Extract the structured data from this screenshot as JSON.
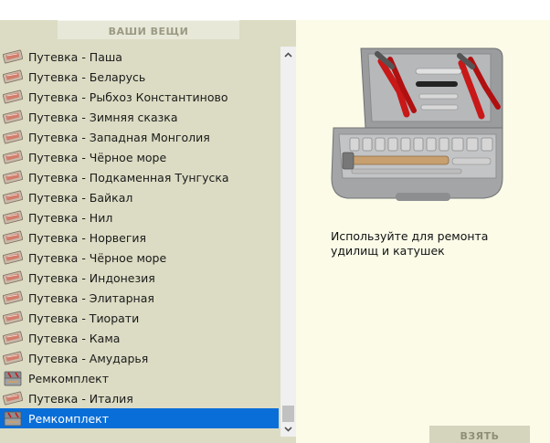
{
  "inventory": {
    "title": "ВАШИ ВЕЩИ",
    "items": [
      {
        "label": "Путевка - Паша",
        "icon": "ticket-icon"
      },
      {
        "label": "Путевка - Беларусь",
        "icon": "ticket-icon"
      },
      {
        "label": "Путевка - Рыбхоз Константиново",
        "icon": "ticket-icon"
      },
      {
        "label": "Путевка - Зимняя сказка",
        "icon": "ticket-icon"
      },
      {
        "label": "Путевка - Западная Монголия",
        "icon": "ticket-icon"
      },
      {
        "label": "Путевка - Чёрное море",
        "icon": "ticket-icon"
      },
      {
        "label": "Путевка - Подкаменная Тунгуска",
        "icon": "ticket-icon"
      },
      {
        "label": "Путевка - Байкал",
        "icon": "ticket-icon"
      },
      {
        "label": "Путевка - Нил",
        "icon": "ticket-icon"
      },
      {
        "label": "Путевка - Норвегия",
        "icon": "ticket-icon"
      },
      {
        "label": "Путевка - Чёрное море",
        "icon": "ticket-icon"
      },
      {
        "label": "Путевка - Индонезия",
        "icon": "ticket-icon"
      },
      {
        "label": "Путевка - Элитарная",
        "icon": "ticket-icon"
      },
      {
        "label": "Путевка - Тиорати",
        "icon": "ticket-icon"
      },
      {
        "label": "Путевка - Кама",
        "icon": "ticket-icon"
      },
      {
        "label": "Путевка - Амударья",
        "icon": "ticket-icon"
      },
      {
        "label": "Ремкомплект",
        "icon": "toolkit-icon"
      },
      {
        "label": "Путевка - Италия",
        "icon": "ticket-icon"
      },
      {
        "label": "Ремкомплект",
        "icon": "toolkit-icon",
        "selected": true
      }
    ]
  },
  "detail": {
    "image": "toolkit-image",
    "description": "Используйте для ремонта удилищ и катушек",
    "action_label": "ВЗЯТЬ"
  },
  "colors": {
    "panel": "#dcdcc4",
    "detail_bg": "#fbfbe8",
    "selection": "#0a6ed8"
  }
}
